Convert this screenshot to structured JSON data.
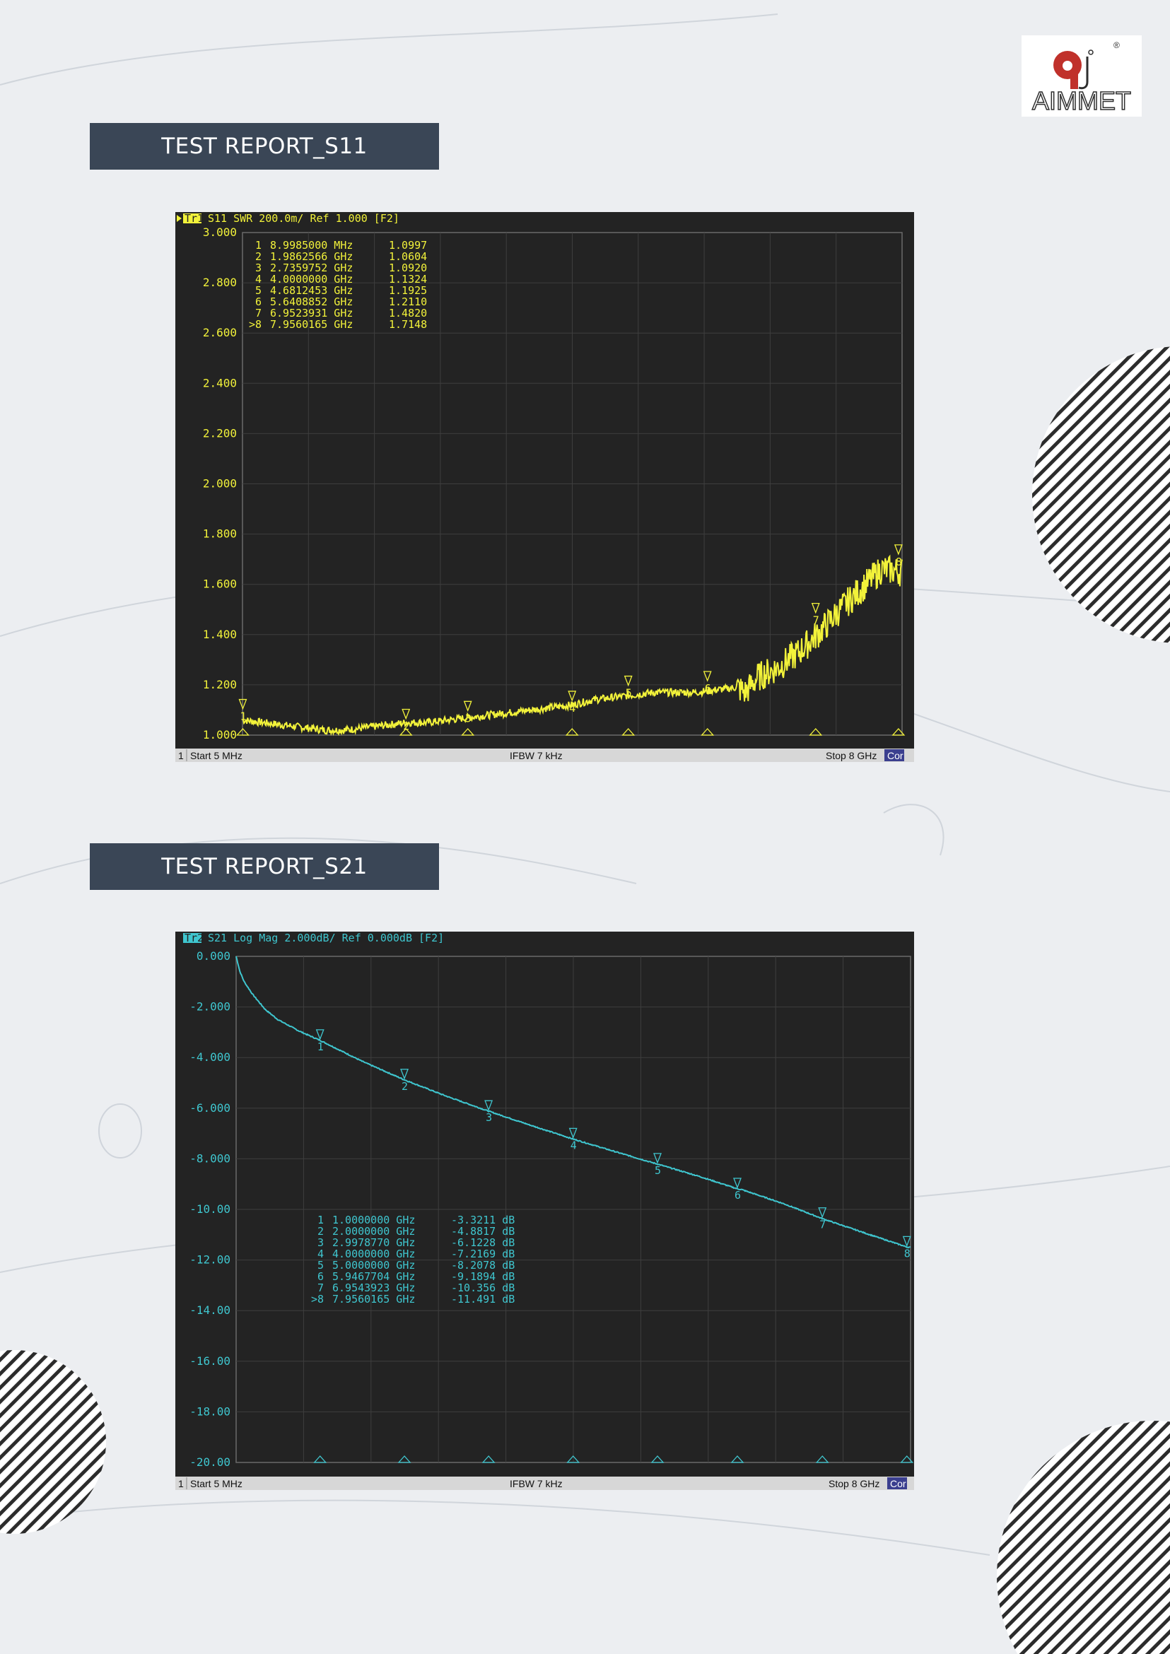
{
  "brand": {
    "name": "AIMMET",
    "registered": "®",
    "accent": "#c0312b",
    "dark": "#2e2e2e"
  },
  "sections": [
    {
      "heading": "TEST REPORT_S11"
    },
    {
      "heading": "TEST REPORT_S21"
    }
  ],
  "analyzer": {
    "trace1": {
      "tag": "Tr1",
      "header": "S11 SWR 200.0m/ Ref 1.000 [F2]",
      "color": "#f2f23a",
      "yticks": [
        "3.000",
        "2.800",
        "2.600",
        "2.400",
        "2.200",
        "2.000",
        "1.800",
        "1.600",
        "1.400",
        "1.200",
        "1.000"
      ],
      "markers": [
        {
          "id": "1",
          "freq": "8.9985000 MHz",
          "value": "1.0997"
        },
        {
          "id": "2",
          "freq": "1.9862566 GHz",
          "value": "1.0604"
        },
        {
          "id": "3",
          "freq": "2.7359752 GHz",
          "value": "1.0920"
        },
        {
          "id": "4",
          "freq": "4.0000000 GHz",
          "value": "1.1324"
        },
        {
          "id": "5",
          "freq": "4.6812453 GHz",
          "value": "1.1925"
        },
        {
          "id": "6",
          "freq": "5.6408852 GHz",
          "value": "1.2110"
        },
        {
          "id": "7",
          "freq": "6.9523931 GHz",
          "value": "1.4820"
        },
        {
          "id": ">8",
          "freq": "7.9560165 GHz",
          "value": "1.7148"
        }
      ],
      "status": {
        "channel": "1",
        "start": "Start 5 MHz",
        "ifbw": "IFBW 7 kHz",
        "stop": "Stop 8 GHz",
        "cor": "Cor"
      }
    },
    "trace2": {
      "tag": "Tr2",
      "header": "S21 Log Mag 2.000dB/ Ref 0.000dB [F2]",
      "color": "#3fc6cf",
      "yticks": [
        "0.000",
        "-2.000",
        "-4.000",
        "-6.000",
        "-8.000",
        "-10.00",
        "-12.00",
        "-14.00",
        "-16.00",
        "-18.00",
        "-20.00"
      ],
      "markers": [
        {
          "id": "1",
          "freq": "1.0000000 GHz",
          "value": "-3.3211 dB"
        },
        {
          "id": "2",
          "freq": "2.0000000 GHz",
          "value": "-4.8817 dB"
        },
        {
          "id": "3",
          "freq": "2.9978770 GHz",
          "value": "-6.1228 dB"
        },
        {
          "id": "4",
          "freq": "4.0000000 GHz",
          "value": "-7.2169 dB"
        },
        {
          "id": "5",
          "freq": "5.0000000 GHz",
          "value": "-8.2078 dB"
        },
        {
          "id": "6",
          "freq": "5.9467704 GHz",
          "value": "-9.1894 dB"
        },
        {
          "id": "7",
          "freq": "6.9543923 GHz",
          "value": "-10.356 dB"
        },
        {
          "id": ">8",
          "freq": "7.9560165 GHz",
          "value": "-11.491 dB"
        }
      ],
      "status": {
        "channel": "1",
        "start": "Start 5 MHz",
        "ifbw": "IFBW 7 kHz",
        "stop": "Stop 8 GHz",
        "cor": "Cor"
      }
    }
  },
  "chart_data": [
    {
      "type": "line",
      "title": "S11 SWR 200.0m/ Ref 1.000 [F2]",
      "xlabel": "",
      "ylabel": "",
      "xlim": [
        0.005,
        8
      ],
      "ylim": [
        1.0,
        3.0
      ],
      "grid": true,
      "series": [
        {
          "name": "S11",
          "color": "#f2f23a",
          "x": [
            0.005,
            0.25,
            0.5,
            0.75,
            1.0,
            1.25,
            1.5,
            1.75,
            2.0,
            2.25,
            2.5,
            2.75,
            3.0,
            3.25,
            3.5,
            3.75,
            4.0,
            4.25,
            4.5,
            4.75,
            5.0,
            5.25,
            5.5,
            5.75,
            6.0,
            6.1,
            6.25,
            6.5,
            6.75,
            7.0,
            7.25,
            7.5,
            7.75,
            8.0
          ],
          "y": [
            1.06,
            1.05,
            1.04,
            1.03,
            1.02,
            1.02,
            1.03,
            1.04,
            1.05,
            1.05,
            1.06,
            1.07,
            1.08,
            1.09,
            1.1,
            1.11,
            1.12,
            1.14,
            1.15,
            1.16,
            1.17,
            1.17,
            1.17,
            1.18,
            1.19,
            1.17,
            1.23,
            1.27,
            1.33,
            1.41,
            1.5,
            1.58,
            1.66,
            1.65
          ]
        }
      ],
      "markers": [
        {
          "label": "1",
          "x": 0.0089985,
          "y": 1.0997
        },
        {
          "label": "2",
          "x": 1.9862566,
          "y": 1.0604
        },
        {
          "label": "3",
          "x": 2.7359752,
          "y": 1.092
        },
        {
          "label": "4",
          "x": 4.0,
          "y": 1.1324
        },
        {
          "label": "5",
          "x": 4.6812453,
          "y": 1.1925
        },
        {
          "label": "6",
          "x": 5.6408852,
          "y": 1.211
        },
        {
          "label": "7",
          "x": 6.9523931,
          "y": 1.482
        },
        {
          "label": "8",
          "x": 7.9560165,
          "y": 1.7148
        }
      ]
    },
    {
      "type": "line",
      "title": "S21 Log Mag 2.000dB/ Ref 0.000dB [F2]",
      "xlabel": "",
      "ylabel": "",
      "xlim": [
        0.005,
        8
      ],
      "ylim": [
        -20,
        0
      ],
      "grid": true,
      "series": [
        {
          "name": "S21",
          "color": "#3fc6cf",
          "x": [
            0.005,
            0.05,
            0.1,
            0.2,
            0.35,
            0.5,
            0.75,
            1.0,
            1.5,
            2.0,
            2.5,
            3.0,
            3.5,
            4.0,
            4.5,
            5.0,
            5.5,
            5.95,
            6.0,
            6.5,
            6.95,
            7.5,
            7.96,
            8.0
          ],
          "y": [
            0.0,
            -0.6,
            -1.0,
            -1.5,
            -2.1,
            -2.5,
            -2.95,
            -3.32,
            -4.15,
            -4.88,
            -5.53,
            -6.12,
            -6.68,
            -7.22,
            -7.72,
            -8.21,
            -8.7,
            -9.19,
            -9.22,
            -9.78,
            -10.36,
            -10.98,
            -11.49,
            -11.5
          ]
        }
      ],
      "markers": [
        {
          "label": "1",
          "x": 1.0,
          "y": -3.3211
        },
        {
          "label": "2",
          "x": 2.0,
          "y": -4.8817
        },
        {
          "label": "3",
          "x": 2.997877,
          "y": -6.1228
        },
        {
          "label": "4",
          "x": 4.0,
          "y": -7.2169
        },
        {
          "label": "5",
          "x": 5.0,
          "y": -8.2078
        },
        {
          "label": "6",
          "x": 5.9467704,
          "y": -9.1894
        },
        {
          "label": "7",
          "x": 6.9543923,
          "y": -10.356
        },
        {
          "label": "8",
          "x": 7.9560165,
          "y": -11.491
        }
      ]
    }
  ]
}
